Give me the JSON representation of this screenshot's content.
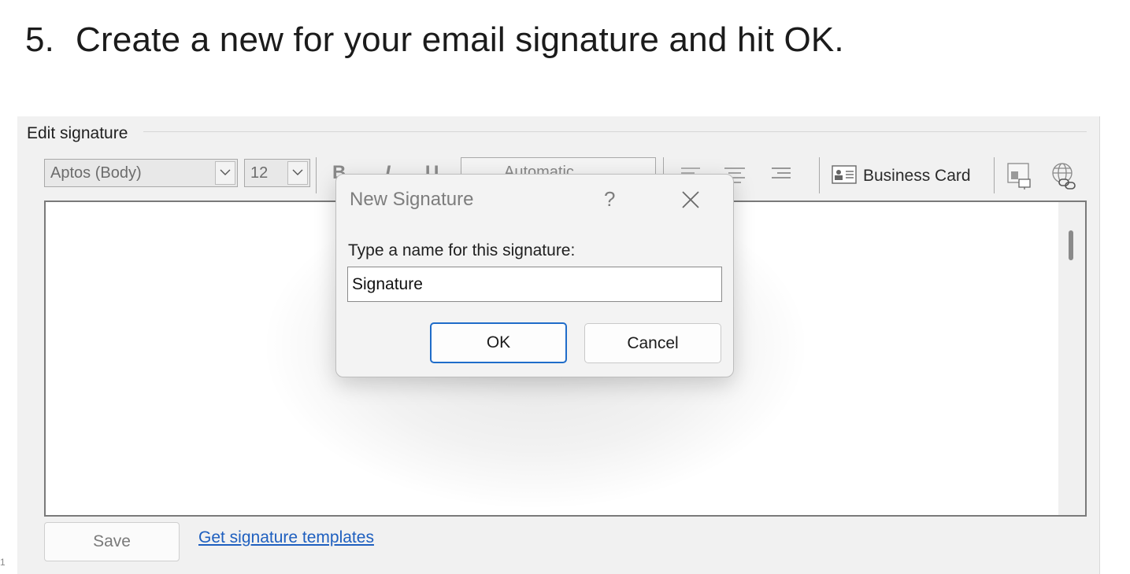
{
  "instruction": {
    "step_number": "5.",
    "text": "Create a new for your email signature and hit OK."
  },
  "edit_section": {
    "title": "Edit signature",
    "font_name": "Aptos (Body)",
    "font_size": "12",
    "bold": "B",
    "italic": "I",
    "underline": "U",
    "color_value": "Automatic",
    "business_card_label": "Business Card",
    "save_label": "Save",
    "templates_link": "Get signature templates"
  },
  "dialog": {
    "title": "New Signature",
    "help": "?",
    "prompt": "Type a name for this signature:",
    "input_value": "Signature",
    "ok_label": "OK",
    "cancel_label": "Cancel"
  },
  "page_marker": "1",
  "colors": {
    "accent": "#1f6cc9",
    "link": "#1e5fbf",
    "panel_bg": "#f1f1f1"
  },
  "icons": [
    "chevron-down-icon",
    "align-left-icon",
    "align-center-icon",
    "align-right-icon",
    "business-card-icon",
    "insert-picture-icon",
    "hyperlink-icon",
    "close-icon"
  ]
}
